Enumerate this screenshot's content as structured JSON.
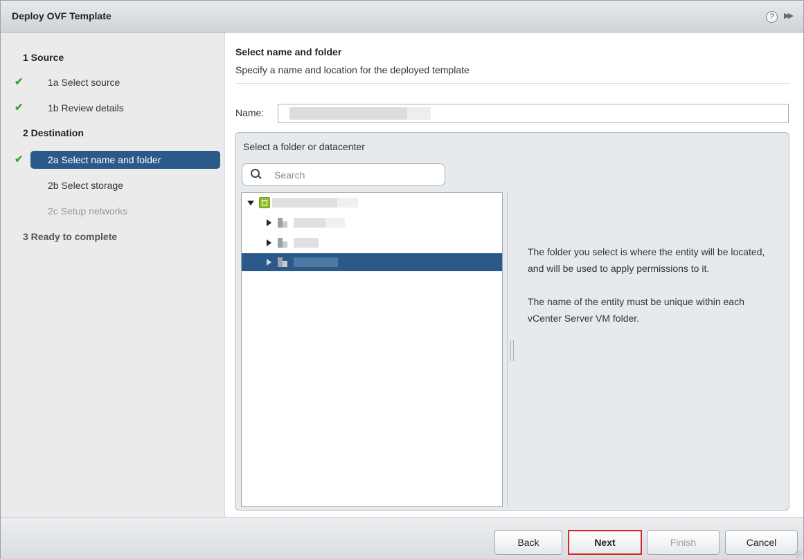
{
  "dialog": {
    "title": "Deploy OVF Template",
    "help_glyph": "?",
    "collapse_glyph": "▶▶"
  },
  "nav": {
    "items": [
      {
        "label": "1 Source",
        "type": "step",
        "checked": false,
        "selected": false,
        "disabled": false
      },
      {
        "label": "1a Select source",
        "type": "sub",
        "checked": true,
        "selected": false,
        "disabled": false
      },
      {
        "label": "1b Review details",
        "type": "sub",
        "checked": true,
        "selected": false,
        "disabled": false
      },
      {
        "label": "2 Destination",
        "type": "step",
        "checked": false,
        "selected": false,
        "disabled": false
      },
      {
        "label": "2a Select name and folder",
        "type": "sub",
        "checked": true,
        "selected": true,
        "disabled": false
      },
      {
        "label": "2b Select storage",
        "type": "sub",
        "checked": false,
        "selected": false,
        "disabled": false
      },
      {
        "label": "2c Setup networks",
        "type": "sub",
        "checked": false,
        "selected": false,
        "disabled": true
      },
      {
        "label": "3 Ready to complete",
        "type": "step",
        "checked": false,
        "selected": false,
        "disabled": true
      }
    ]
  },
  "main": {
    "title": "Select name and folder",
    "subtitle": "Specify a name and location for the deployed template",
    "name_label": "Name:",
    "name_value": "",
    "folder_panel": {
      "title": "Select a folder or datacenter",
      "search_placeholder": "Search",
      "help_paragraph_1": "The folder you select is where the entity will be located, and will be used to apply permissions to it.",
      "help_paragraph_2": "The name of the entity must be unique within each vCenter Server VM folder."
    }
  },
  "footer": {
    "back_label": "Back",
    "next_label": "Next",
    "finish_label": "Finish",
    "cancel_label": "Cancel"
  },
  "colors": {
    "selection": "#2b5a8a",
    "check": "#3aa13a",
    "highlight_border": "#d92525"
  }
}
